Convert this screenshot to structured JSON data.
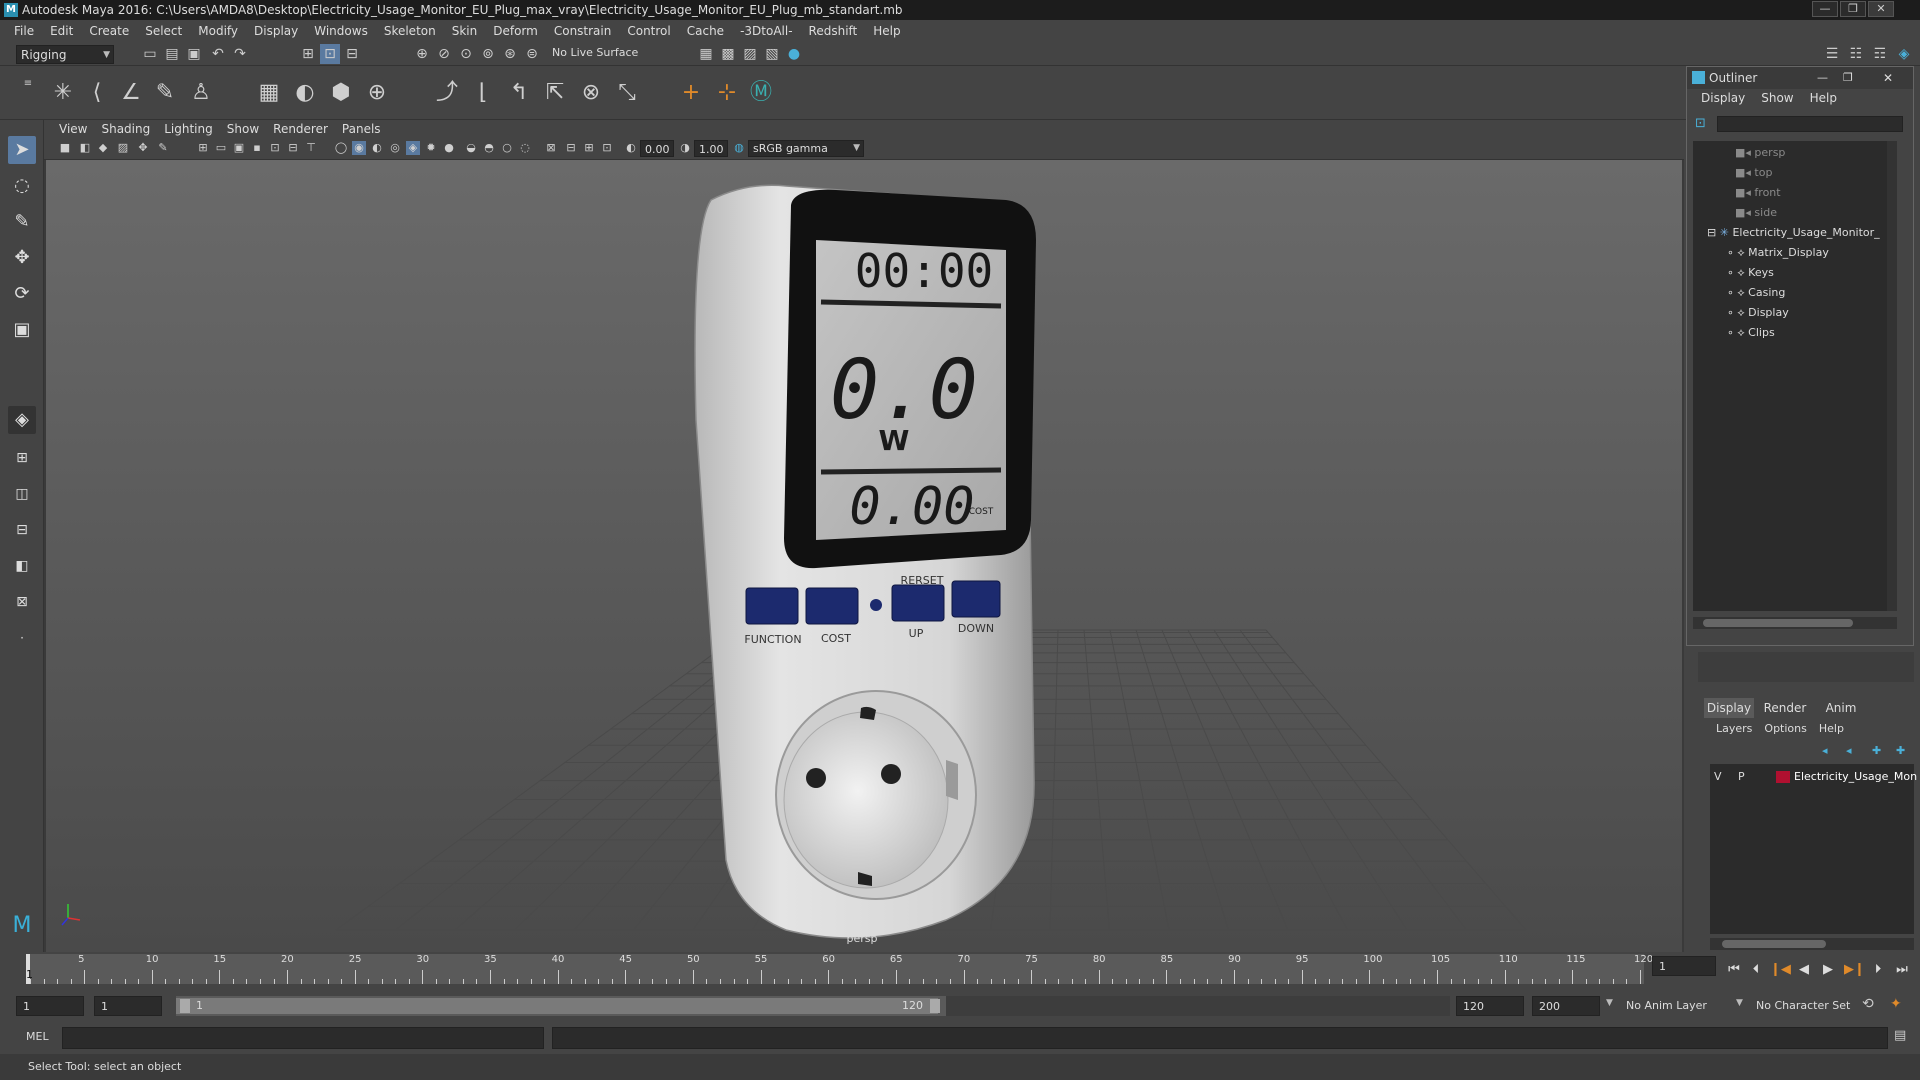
{
  "window": {
    "title": "Autodesk Maya 2016: C:\\Users\\AMDA8\\Desktop\\Electricity_Usage_Monitor_EU_Plug_max_vray\\Electricity_Usage_Monitor_EU_Plug_mb_standart.mb",
    "buttons": [
      "—",
      "❐",
      "✕"
    ]
  },
  "menubar": [
    "File",
    "Edit",
    "Create",
    "Select",
    "Modify",
    "Display",
    "Windows",
    "Skeleton",
    "Skin",
    "Deform",
    "Constrain",
    "Control",
    "Cache",
    "-3DtoAll-",
    "Redshift",
    "Help"
  ],
  "status_line": {
    "mode": "Rigging",
    "live_surface": "No Live Surface"
  },
  "viewport": {
    "menu": [
      "View",
      "Shading",
      "Lighting",
      "Show",
      "Renderer",
      "Panels"
    ],
    "exposure": "0.00",
    "gamma": "1.00",
    "color_space": "sRGB gamma",
    "camera_label": "persp",
    "model": {
      "time": "00:00",
      "power": "0.0",
      "unit": "W",
      "cost": "0.00",
      "cost_label": "COST",
      "reset_label": "RERSET",
      "buttons": [
        "FUNCTION",
        "COST",
        "UP",
        "DOWN"
      ]
    }
  },
  "outliner": {
    "title": "Outliner",
    "menu": [
      "Display",
      "Show",
      "Help"
    ],
    "cameras": [
      "persp",
      "top",
      "front",
      "side"
    ],
    "root": "Electricity_Usage_Monitor_",
    "children": [
      "Matrix_Display",
      "Keys",
      "Casing",
      "Display",
      "Clips"
    ]
  },
  "layer_editor": {
    "tabs": [
      "Display",
      "Render",
      "Anim"
    ],
    "active_tab": "Display",
    "menu": [
      "Layers",
      "Options",
      "Help"
    ],
    "layer": {
      "v": "V",
      "p": "P",
      "name": "Electricity_Usage_Mon",
      "color": "#b01030"
    }
  },
  "timeline": {
    "ticks": [
      "5",
      "10",
      "15",
      "20",
      "25",
      "30",
      "35",
      "40",
      "45",
      "50",
      "55",
      "60",
      "65",
      "70",
      "75",
      "80",
      "85",
      "90",
      "95",
      "100",
      "105",
      "110",
      "115",
      "120"
    ],
    "current_frame_marker": "1",
    "current_frame": "1"
  },
  "range": {
    "start": "1",
    "playback_start": "1",
    "slider_start": "1",
    "slider_end": "120",
    "playback_end": "120",
    "end": "200",
    "anim_layer": "No Anim Layer",
    "character_set": "No Character Set"
  },
  "mel": {
    "label": "MEL"
  },
  "help_line": "Select Tool: select an object"
}
